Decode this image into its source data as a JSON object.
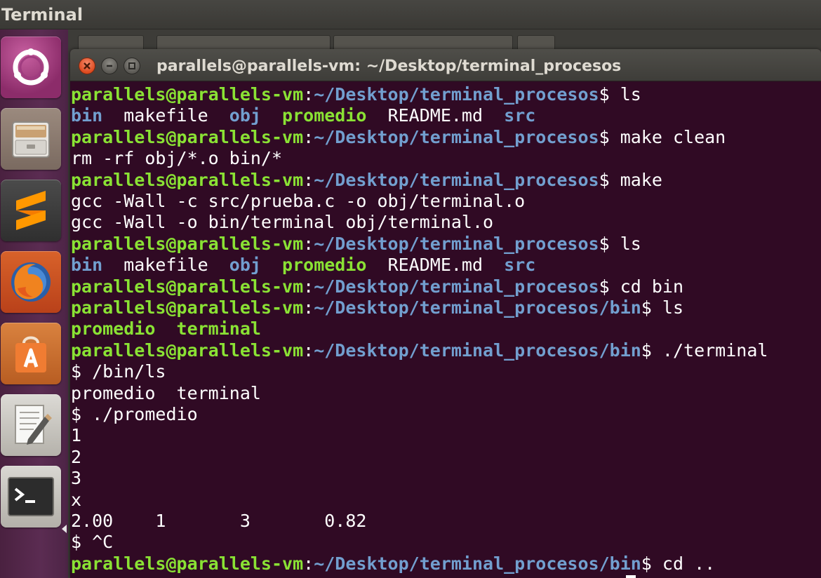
{
  "top_panel": {
    "title": "Terminal"
  },
  "launcher": {
    "items": [
      {
        "name": "ubuntu-dash",
        "icon": "ubuntu-logo-icon"
      },
      {
        "name": "files",
        "icon": "file-cabinet-icon"
      },
      {
        "name": "sublime-text",
        "icon": "sublime-text-icon"
      },
      {
        "name": "firefox",
        "icon": "firefox-icon"
      },
      {
        "name": "software-center",
        "icon": "shopping-bag-icon"
      },
      {
        "name": "text-editor",
        "icon": "text-editor-icon"
      },
      {
        "name": "terminal",
        "icon": "terminal-icon"
      }
    ]
  },
  "window": {
    "title": "parallels@parallels-vm: ~/Desktop/terminal_procesos"
  },
  "colors": {
    "terminal_bg": "#300a24",
    "prompt_user": "#8ae234",
    "prompt_path": "#729fcf",
    "text": "#ffffff",
    "launcher_bg": "#5b2c52"
  },
  "terminal": {
    "lines": [
      {
        "type": "prompt",
        "user": "parallels@parallels-vm",
        "path": "~/Desktop/terminal_procesos",
        "cmd": " ls"
      },
      {
        "type": "ls",
        "items": [
          {
            "t": "bin",
            "c": "dir"
          },
          {
            "t": "  makefile  ",
            "c": "fg"
          },
          {
            "t": "obj",
            "c": "dir"
          },
          {
            "t": "  ",
            "c": "fg"
          },
          {
            "t": "promedio",
            "c": "exe"
          },
          {
            "t": "  README.md  ",
            "c": "fg"
          },
          {
            "t": "src",
            "c": "dir"
          }
        ]
      },
      {
        "type": "prompt",
        "user": "parallels@parallels-vm",
        "path": "~/Desktop/terminal_procesos",
        "cmd": " make clean"
      },
      {
        "type": "text",
        "text": "rm -rf obj/*.o bin/*"
      },
      {
        "type": "prompt",
        "user": "parallels@parallels-vm",
        "path": "~/Desktop/terminal_procesos",
        "cmd": " make"
      },
      {
        "type": "text",
        "text": "gcc -Wall -c src/prueba.c -o obj/terminal.o"
      },
      {
        "type": "text",
        "text": "gcc -Wall -o bin/terminal obj/terminal.o"
      },
      {
        "type": "prompt",
        "user": "parallels@parallels-vm",
        "path": "~/Desktop/terminal_procesos",
        "cmd": " ls"
      },
      {
        "type": "ls",
        "items": [
          {
            "t": "bin",
            "c": "dir"
          },
          {
            "t": "  makefile  ",
            "c": "fg"
          },
          {
            "t": "obj",
            "c": "dir"
          },
          {
            "t": "  ",
            "c": "fg"
          },
          {
            "t": "promedio",
            "c": "exe"
          },
          {
            "t": "  README.md  ",
            "c": "fg"
          },
          {
            "t": "src",
            "c": "dir"
          }
        ]
      },
      {
        "type": "prompt",
        "user": "parallels@parallels-vm",
        "path": "~/Desktop/terminal_procesos",
        "cmd": " cd bin"
      },
      {
        "type": "prompt",
        "user": "parallels@parallels-vm",
        "path": "~/Desktop/terminal_procesos/bin",
        "cmd": " ls"
      },
      {
        "type": "ls",
        "items": [
          {
            "t": "promedio",
            "c": "exe"
          },
          {
            "t": "  ",
            "c": "fg"
          },
          {
            "t": "terminal",
            "c": "exe"
          }
        ]
      },
      {
        "type": "prompt",
        "user": "parallels@parallels-vm",
        "path": "~/Desktop/terminal_procesos/bin",
        "cmd": " ./terminal"
      },
      {
        "type": "text",
        "text": "$ /bin/ls"
      },
      {
        "type": "text",
        "text": "promedio  terminal"
      },
      {
        "type": "text",
        "text": "$ ./promedio"
      },
      {
        "type": "text",
        "text": "1"
      },
      {
        "type": "text",
        "text": "2"
      },
      {
        "type": "text",
        "text": "3"
      },
      {
        "type": "text",
        "text": "x"
      },
      {
        "type": "text",
        "text": "2.00    1       3       0.82"
      },
      {
        "type": "text",
        "text": "$ ^C"
      },
      {
        "type": "prompt",
        "user": "parallels@parallels-vm",
        "path": "~/Desktop/terminal_procesos/bin",
        "cmd": " cd .."
      }
    ]
  }
}
